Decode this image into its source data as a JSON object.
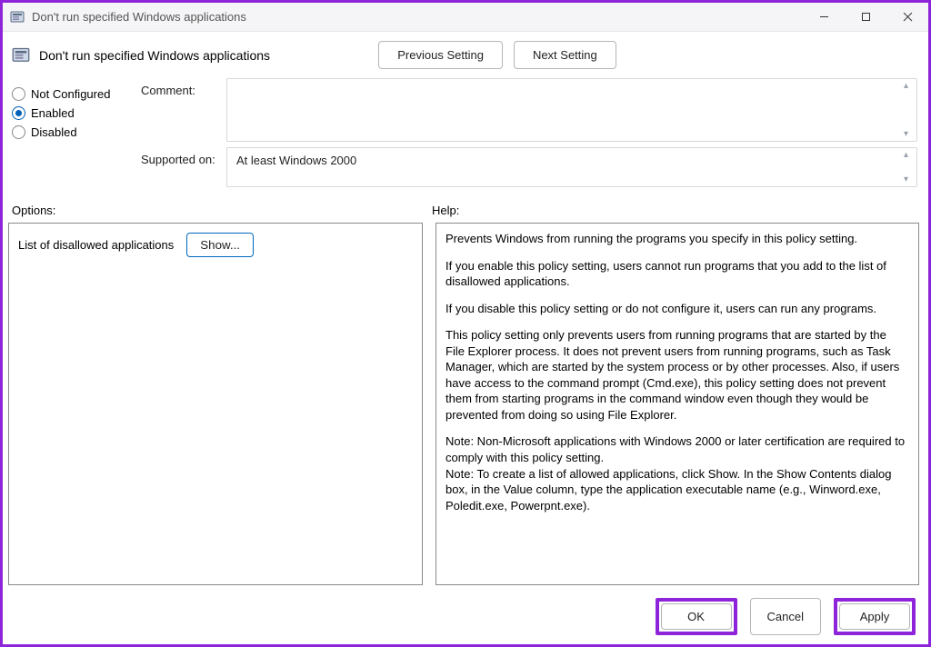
{
  "window": {
    "title": "Don't run specified Windows applications"
  },
  "policy_name": "Don't run specified Windows applications",
  "nav": {
    "previous": "Previous Setting",
    "next": "Next Setting"
  },
  "state": {
    "not_configured": "Not Configured",
    "enabled": "Enabled",
    "disabled": "Disabled",
    "selected": "enabled"
  },
  "labels": {
    "comment": "Comment:",
    "supported": "Supported on:",
    "options": "Options:",
    "help": "Help:",
    "disallowed": "List of disallowed applications",
    "show": "Show..."
  },
  "comment": "",
  "supported_on": "At least Windows 2000",
  "help": {
    "p1": "Prevents Windows from running the programs you specify in this policy setting.",
    "p2": "If you enable this policy setting, users cannot run programs that you add to the list of disallowed applications.",
    "p3": "If you disable this policy setting or do not configure it, users can run any programs.",
    "p4": "This policy setting only prevents users from running programs that are started by the File Explorer process. It does not prevent users from running programs, such as Task Manager, which are started by the system process or by other processes.  Also, if users have access to the command prompt (Cmd.exe), this policy setting does not prevent them from starting programs in the command window even though they would be prevented from doing so using File Explorer.",
    "p5": "Note: Non-Microsoft applications with Windows 2000 or later certification are required to comply with this policy setting.",
    "p6": "Note: To create a list of allowed applications, click Show.  In the Show Contents dialog box, in the Value column, type the application executable name (e.g., Winword.exe, Poledit.exe, Powerpnt.exe)."
  },
  "footer": {
    "ok": "OK",
    "cancel": "Cancel",
    "apply": "Apply"
  }
}
